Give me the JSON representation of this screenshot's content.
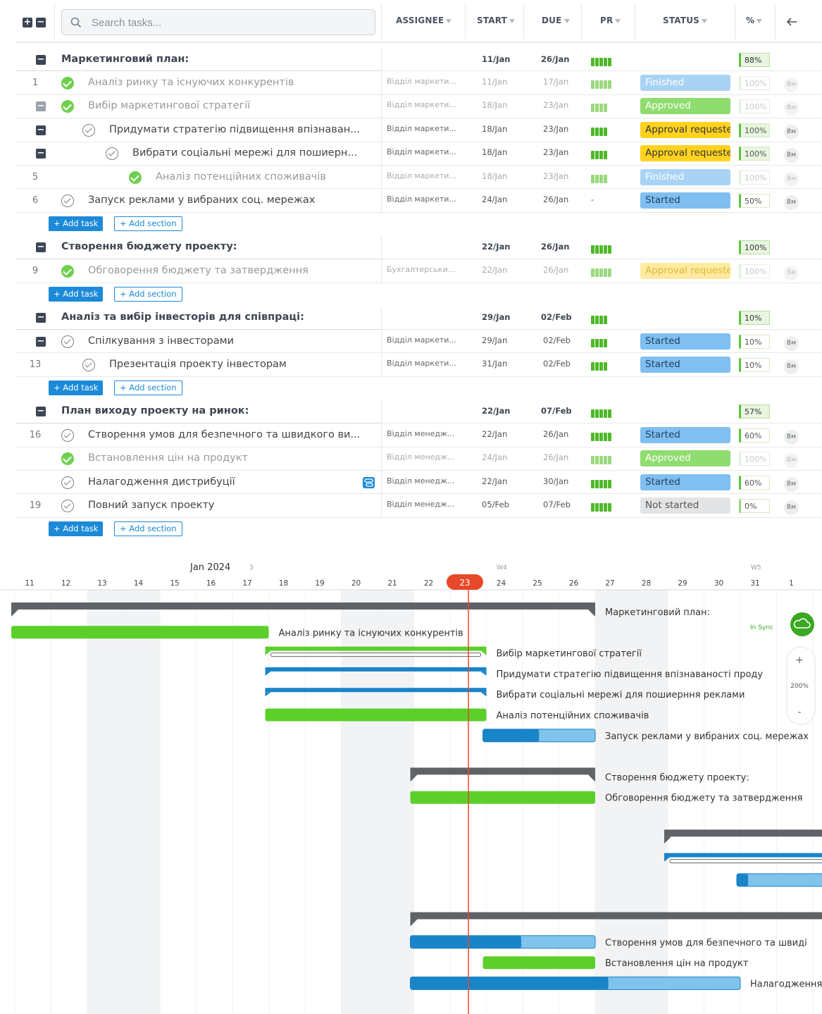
{
  "header": {
    "search_placeholder": "Search tasks...",
    "columns": [
      "ASSIGNEE",
      "START",
      "DUE",
      "PR",
      "STATUS",
      "%"
    ]
  },
  "rows": [
    {
      "kind": "section",
      "title": "Маркетинговий план:",
      "start": "11/Jan",
      "due": "26/Jan",
      "pr": 5,
      "pct": "88%"
    },
    {
      "kind": "task",
      "num": "1",
      "title": "Аналіз ринку та існуючих конкурентів",
      "assignee": "Відділ маркети...",
      "start": "11/Jan",
      "due": "17/Jan",
      "pr": 5,
      "status": "Finished",
      "pct": "100%",
      "avatar": "Вм",
      "done": true,
      "dim": true,
      "indent": 0
    },
    {
      "kind": "task",
      "num": "",
      "title": "Вибір маркетингової стратегії",
      "assignee": "Відділ маркети...",
      "start": "18/Jan",
      "due": "23/Jan",
      "pr": 4,
      "status": "Approved",
      "pct": "100%",
      "avatar": "Вм",
      "done": true,
      "dim": true,
      "indent": 0,
      "collapse": true
    },
    {
      "kind": "task",
      "num": "",
      "title": "Придумати стратегію підвищення впізнаван...",
      "assignee": "Відділ маркети...",
      "start": "18/Jan",
      "due": "23/Jan",
      "pr": 4,
      "status": "Approval requested",
      "pct": "100%",
      "avatar": "Вм",
      "done": false,
      "dim": false,
      "indent": 1,
      "collapse": true
    },
    {
      "kind": "task",
      "num": "",
      "title": "Вибрати соціальні мережі для пошиерн...",
      "assignee": "Відділ маркети...",
      "start": "18/Jan",
      "due": "23/Jan",
      "pr": 4,
      "status": "Approval requested",
      "pct": "100%",
      "avatar": "Вм",
      "done": false,
      "dim": false,
      "indent": 2,
      "collapse": true
    },
    {
      "kind": "task",
      "num": "5",
      "title": "Аналіз потенційних споживачів",
      "assignee": "Відділ маркети...",
      "start": "18/Jan",
      "due": "23/Jan",
      "pr": 4,
      "status": "Finished",
      "pct": "100%",
      "avatar": "Вм",
      "done": true,
      "dim": true,
      "indent": 3
    },
    {
      "kind": "task",
      "num": "6",
      "title": "Запуск реклами у вибраних соц. мережах",
      "assignee": "Відділ маркети...",
      "start": "24/Jan",
      "due": "26/Jan",
      "pr": 0,
      "status": "Started",
      "pct": "50%",
      "avatar": "Вм",
      "done": false,
      "dim": false,
      "indent": 0
    },
    {
      "kind": "buttons"
    },
    {
      "kind": "section",
      "title": "Створення бюджету проекту:",
      "start": "22/Jan",
      "due": "26/Jan",
      "pr": 5,
      "pct": "100%"
    },
    {
      "kind": "task",
      "num": "9",
      "title": "Обговорення бюджету та затвердження",
      "assignee": "Бухгалтерськи...",
      "start": "22/Jan",
      "due": "26/Jan",
      "pr": 5,
      "status": "Approval requested",
      "pct": "100%",
      "avatar": "Бв",
      "done": true,
      "dim": true,
      "indent": 0
    },
    {
      "kind": "buttons"
    },
    {
      "kind": "section",
      "title": "Аналіз та вибір інвесторів для співпраці:",
      "start": "29/Jan",
      "due": "02/Feb",
      "pr": 4,
      "pct": "10%"
    },
    {
      "kind": "task",
      "num": "",
      "title": "Спілкування з інвесторами",
      "assignee": "Відділ маркети...",
      "start": "29/Jan",
      "due": "02/Feb",
      "pr": 4,
      "status": "Started",
      "pct": "10%",
      "avatar": "Вм",
      "done": false,
      "dim": false,
      "indent": 0,
      "collapse": true
    },
    {
      "kind": "task",
      "num": "13",
      "title": "Презентація проекту інвесторам",
      "assignee": "Відділ маркети...",
      "start": "31/Jan",
      "due": "02/Feb",
      "pr": 4,
      "status": "Started",
      "pct": "10%",
      "avatar": "Вм",
      "done": false,
      "dim": false,
      "indent": 1
    },
    {
      "kind": "buttons"
    },
    {
      "kind": "section",
      "title": "План виходу проекту на ринок:",
      "start": "22/Jan",
      "due": "07/Feb",
      "pr": 5,
      "pct": "57%"
    },
    {
      "kind": "task",
      "num": "16",
      "title": "Створення умов для безпечного та швидкого ви...",
      "assignee": "Відділ менедж...",
      "start": "22/Jan",
      "due": "26/Jan",
      "pr": 5,
      "status": "Started",
      "pct": "60%",
      "avatar": "Вм",
      "done": false,
      "dim": false,
      "indent": 0
    },
    {
      "kind": "task",
      "num": "",
      "title": "Встановлення цін на продукт",
      "assignee": "Відділ менедж...",
      "start": "24/Jan",
      "due": "26/Jan",
      "pr": 5,
      "status": "Approved",
      "pct": "100%",
      "avatar": "Вм",
      "done": true,
      "dim": true,
      "indent": 0
    },
    {
      "kind": "task",
      "num": "",
      "title": "Налагодження дистрибуції",
      "assignee": "Відділ менедж...",
      "start": "22/Jan",
      "due": "30/Jan",
      "pr": 5,
      "status": "Started",
      "pct": "60%",
      "avatar": "Вм",
      "done": false,
      "dim": false,
      "indent": 0,
      "comment": true
    },
    {
      "kind": "task",
      "num": "19",
      "title": "Повний запуск проекту",
      "assignee": "Відділ менедж...",
      "start": "05/Feb",
      "due": "07/Feb",
      "pr": 5,
      "status": "Not started",
      "pct": "0%",
      "avatar": "Вм",
      "done": false,
      "dim": false,
      "indent": 0
    },
    {
      "kind": "buttons"
    }
  ],
  "buttons": {
    "add_task": "Add task",
    "add_section": "Add section"
  },
  "status_colors": {
    "Finished": "#a9d3f5",
    "Approved": "#8fdc6f",
    "Approval requested": "#ffd21f",
    "Started": "#7fbff2",
    "Not started": "#e2e4e6"
  },
  "gantt": {
    "month_label": "Jan 2024",
    "week_labels": [
      "3",
      "W4",
      "W5"
    ],
    "days": [
      "11",
      "12",
      "13",
      "14",
      "15",
      "16",
      "17",
      "18",
      "19",
      "20",
      "21",
      "22",
      "23",
      "24",
      "25",
      "26",
      "27",
      "28",
      "29",
      "30",
      "31",
      "1"
    ],
    "today": "23",
    "sync_label": "In Sync",
    "zoom_label": "200%",
    "zoom_in": "+",
    "zoom_out": "-",
    "bars": [
      {
        "label": "Маркетинговий план:",
        "type": "summary",
        "start": 0,
        "end": 16
      },
      {
        "label": "Аналіз ринку та існуючих конкурентів",
        "type": "done",
        "start": 0,
        "end": 7
      },
      {
        "label": "Вибір маркетингової стратегії",
        "type": "done-parent",
        "start": 7,
        "end": 13
      },
      {
        "label": "Придумати стратегію підвищення впізнаваності проду",
        "type": "blue-parent",
        "start": 7,
        "end": 13
      },
      {
        "label": "Вибрати соціальні мережі для пошиерння реклами",
        "type": "blue-parent",
        "start": 7,
        "end": 13
      },
      {
        "label": "Аналіз потенційних споживачів",
        "type": "done",
        "start": 7,
        "end": 13
      },
      {
        "label": "Запуск реклами у вибраних соц. мережах",
        "type": "progress",
        "start": 13,
        "end": 16,
        "progress": 0.5
      },
      {
        "label": "",
        "type": "gap"
      },
      {
        "label": "Створення бюджету проекту:",
        "type": "summary",
        "start": 11,
        "end": 16
      },
      {
        "label": "Обговорення бюджету та затвердження",
        "type": "done",
        "start": 11,
        "end": 16
      },
      {
        "label": "",
        "type": "gap"
      },
      {
        "label": "",
        "type": "summary",
        "start": 18,
        "end": 23
      },
      {
        "label": "",
        "type": "blue-parent",
        "start": 18,
        "end": 23
      },
      {
        "label": "",
        "type": "progress",
        "start": 20,
        "end": 23,
        "progress": 0.1
      },
      {
        "label": "",
        "type": "gap"
      },
      {
        "label": "",
        "type": "summary",
        "start": 11,
        "end": 23
      },
      {
        "label": "Створення умов для безпечного та швиді",
        "type": "progress",
        "start": 11,
        "end": 16,
        "progress": 0.6
      },
      {
        "label": "Встановлення цін на продукт",
        "type": "done",
        "start": 13,
        "end": 16
      },
      {
        "label": "Налагодження",
        "type": "progress",
        "start": 11,
        "end": 20,
        "progress": 0.6
      }
    ]
  }
}
